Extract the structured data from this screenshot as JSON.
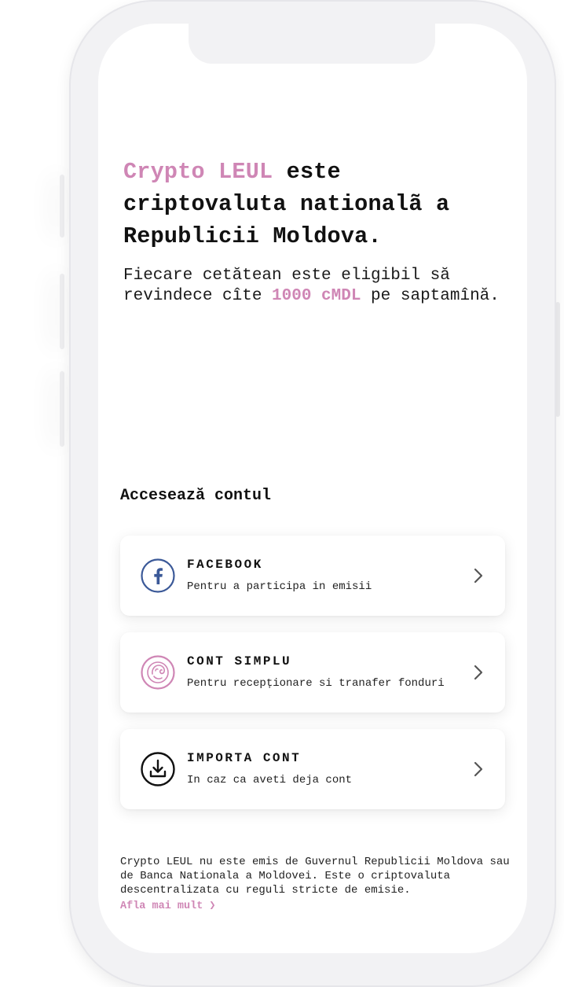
{
  "headline": {
    "brand": "Crypto LEUL",
    "rest": " este criptovaluta nationalã a Republicii Moldova."
  },
  "subtext": {
    "before": "Fiecare cetătean este eligibil să revindece cîte ",
    "amount": "1000 cMDL",
    "after": " pe saptamînă."
  },
  "section_title": "Accesează contul",
  "cards": [
    {
      "title": "FACEBOOK",
      "description": "Pentru a participa in emisii",
      "icon": "facebook-icon",
      "color": "#3b5998"
    },
    {
      "title": "CONT SIMPLU",
      "description": "Pentru recepționare si tranafer fonduri",
      "icon": "lion-icon",
      "color": "#cf86b5"
    },
    {
      "title": "IMPORTA CONT",
      "description": "In caz ca aveti deja cont",
      "icon": "download-icon",
      "color": "#111111"
    }
  ],
  "footer": {
    "text": "Crypto LEUL nu este emis de Guvernul Republicii Moldova sau de Banca Nationala a Moldovei. Este o criptovaluta descentralizata cu reguli stricte de emisie.",
    "link": "Afla mai mult ❯"
  },
  "colors": {
    "accent": "#cf86b5",
    "facebook": "#3b5998",
    "text": "#111111"
  }
}
